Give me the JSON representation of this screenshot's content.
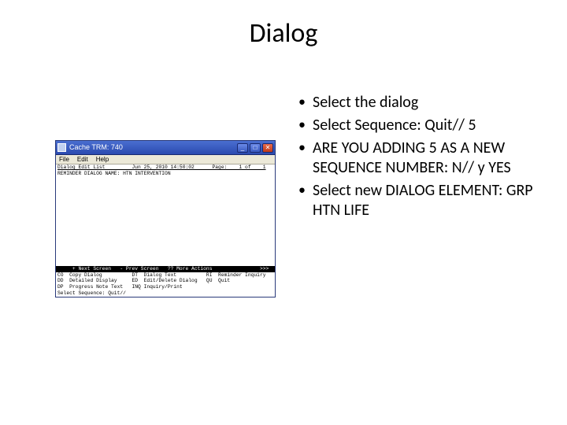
{
  "slide": {
    "title": "Dialog",
    "bullets": [
      "Select the dialog",
      "Select Sequence: Quit// 5",
      "ARE YOU ADDING 5 AS A NEW SEQUENCE NUMBER: N// y  YES",
      "Select new DIALOG ELEMENT: GRP HTN LIFE"
    ]
  },
  "window": {
    "title": "Cache TRM: 740",
    "menu": {
      "file": "File",
      "edit": "Edit",
      "help": "Help"
    },
    "controls": {
      "minimize": "_",
      "maximize": "□",
      "close": "✕"
    },
    "header1": "Dialog Edit List         Jun 25, 2010 14:50:02      Page:    1 of    1",
    "header2": "REMINDER DIALOG NAME: HTN INTERVENTION",
    "actionbar": "     + Next Screen   - Prev Screen   ?? More Actions                >>>",
    "cmds": {
      "r1": "CO  Copy Dialog          DT  Dialog Text          RI  Reminder Inquiry",
      "r2": "DD  Detailed Display     ED  Edit/Delete Dialog   QU  Quit",
      "r3": "DP  Progress Note Text   INQ Inquiry/Print"
    },
    "prompt": "Select Sequence: Quit//"
  }
}
